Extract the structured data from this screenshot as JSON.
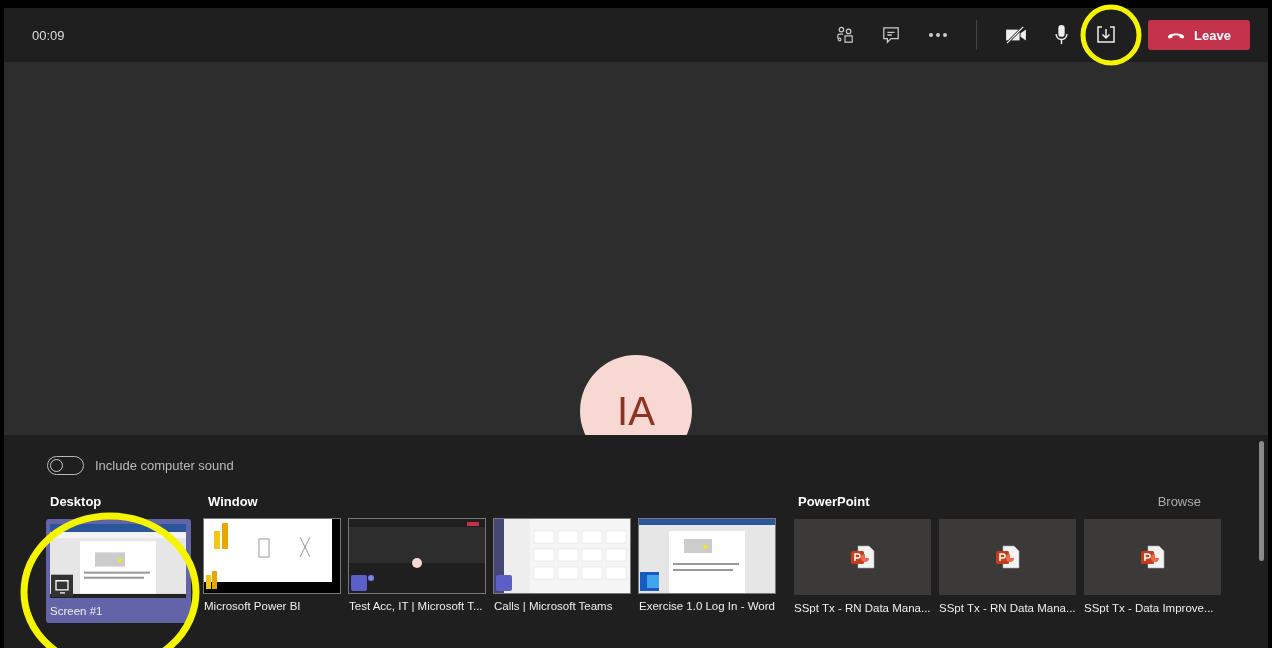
{
  "call_bar": {
    "timer": "00:09",
    "camera_off": true,
    "leave_label": "Leave"
  },
  "avatar": {
    "initials": "IA"
  },
  "share_tray": {
    "computer_sound": {
      "label": "Include computer sound",
      "on": false
    },
    "desktop": {
      "title": "Desktop",
      "items": [
        {
          "label": "Screen #1",
          "selected": true
        }
      ]
    },
    "window": {
      "title": "Window",
      "items": [
        {
          "label": "Microsoft Power BI",
          "kind": "powerbi",
          "selected": false
        },
        {
          "label": "Test Acc, IT | Microsoft T...",
          "kind": "meeting",
          "selected": false
        },
        {
          "label": "Calls | Microsoft Teams",
          "kind": "teams",
          "selected": false
        },
        {
          "label": "Exercise 1.0 Log In - Word",
          "kind": "word",
          "selected": false
        }
      ]
    },
    "powerpoint": {
      "title": "PowerPoint",
      "browse": "Browse",
      "items": [
        {
          "label": "SSpt Tx - RN Data Mana..."
        },
        {
          "label": "SSpt Tx - RN Data Mana..."
        },
        {
          "label": "SSpt Tx - Data Improve..."
        }
      ]
    }
  }
}
